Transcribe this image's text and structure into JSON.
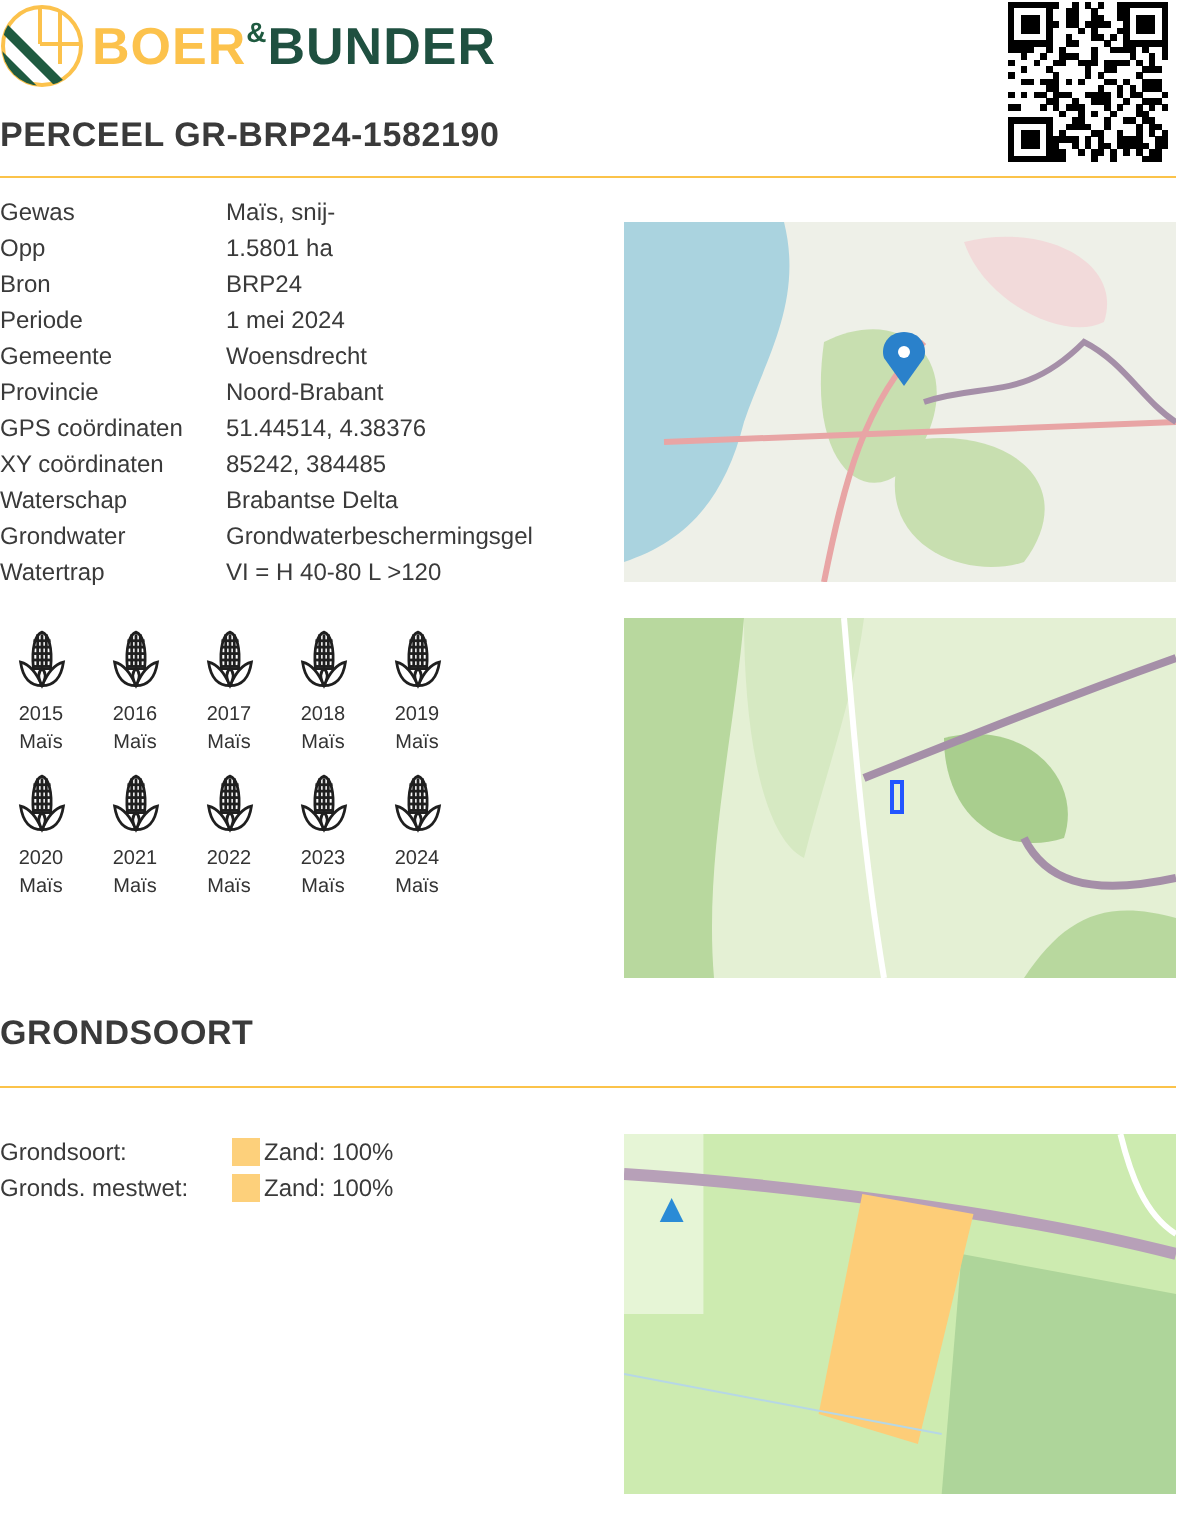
{
  "brand": {
    "parts": [
      "BOER",
      "&",
      "BUNDER"
    ]
  },
  "title": "PERCEEL GR-BRP24-1582190",
  "details": [
    {
      "label": "Gewas",
      "value": "Maïs, snij-"
    },
    {
      "label": "Opp",
      "value": "1.5801 ha"
    },
    {
      "label": "Bron",
      "value": "BRP24"
    },
    {
      "label": "Periode",
      "value": "1 mei 2024"
    },
    {
      "label": "Gemeente",
      "value": "Woensdrecht"
    },
    {
      "label": "Provincie",
      "value": "Noord-Brabant"
    },
    {
      "label": "GPS coördinaten",
      "value": "51.44514, 4.38376"
    },
    {
      "label": "XY coördinaten",
      "value": "85242, 384485"
    },
    {
      "label": "Waterschap",
      "value": "Brabantse Delta"
    },
    {
      "label": "Grondwater",
      "value": "Grondwaterbeschermingsgel"
    },
    {
      "label": "Watertrap",
      "value": "VI = H 40-80 L >120"
    }
  ],
  "crop_history": [
    {
      "year": "2015",
      "crop": "Maïs"
    },
    {
      "year": "2016",
      "crop": "Maïs"
    },
    {
      "year": "2017",
      "crop": "Maïs"
    },
    {
      "year": "2018",
      "crop": "Maïs"
    },
    {
      "year": "2019",
      "crop": "Maïs"
    },
    {
      "year": "2020",
      "crop": "Maïs"
    },
    {
      "year": "2021",
      "crop": "Maïs"
    },
    {
      "year": "2022",
      "crop": "Maïs"
    },
    {
      "year": "2023",
      "crop": "Maïs"
    },
    {
      "year": "2024",
      "crop": "Maïs"
    }
  ],
  "soil_section": {
    "title": "GRONDSOORT",
    "rows": [
      {
        "label": "Grondsoort:",
        "value": "Zand: 100%",
        "color": "#fdd07b"
      },
      {
        "label": "Gronds. mestwet:",
        "value": "Zand: 100%",
        "color": "#fdd07b"
      }
    ]
  }
}
